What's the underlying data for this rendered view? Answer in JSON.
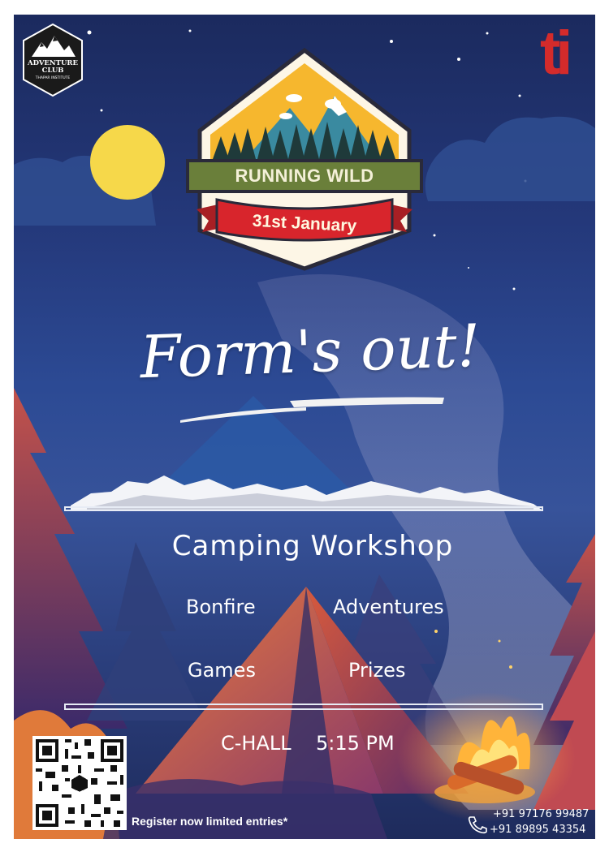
{
  "club_logo": {
    "line1": "ADVENTURE",
    "line2": "CLUB",
    "line3": "THAPAR INSTITUTE"
  },
  "brand_logo": {
    "text": "ti",
    "color": "#d42b2b"
  },
  "badge": {
    "title": "RUNNING WILD",
    "date": "31st January"
  },
  "headline": "Form's out!",
  "event": {
    "title": "Camping  Workshop",
    "features": [
      "Bonfire",
      "Adventures",
      "Games",
      "Prizes"
    ],
    "venue": "C-HALL",
    "time": "5:15 PM"
  },
  "register": "Register now limited entries*",
  "contacts": [
    "+91 97176 99487",
    "+91 89895 43354"
  ],
  "icons": [
    "mountain-logo-icon",
    "phone-icon",
    "qr-code"
  ],
  "colors": {
    "sky_dark": "#1b2a5e",
    "sky_mid": "#2c4a94",
    "tent_orange": "#e06a3a",
    "moon": "#f6d84a",
    "banner_green": "#6a7f3a",
    "ribbon_red": "#d8252c"
  }
}
